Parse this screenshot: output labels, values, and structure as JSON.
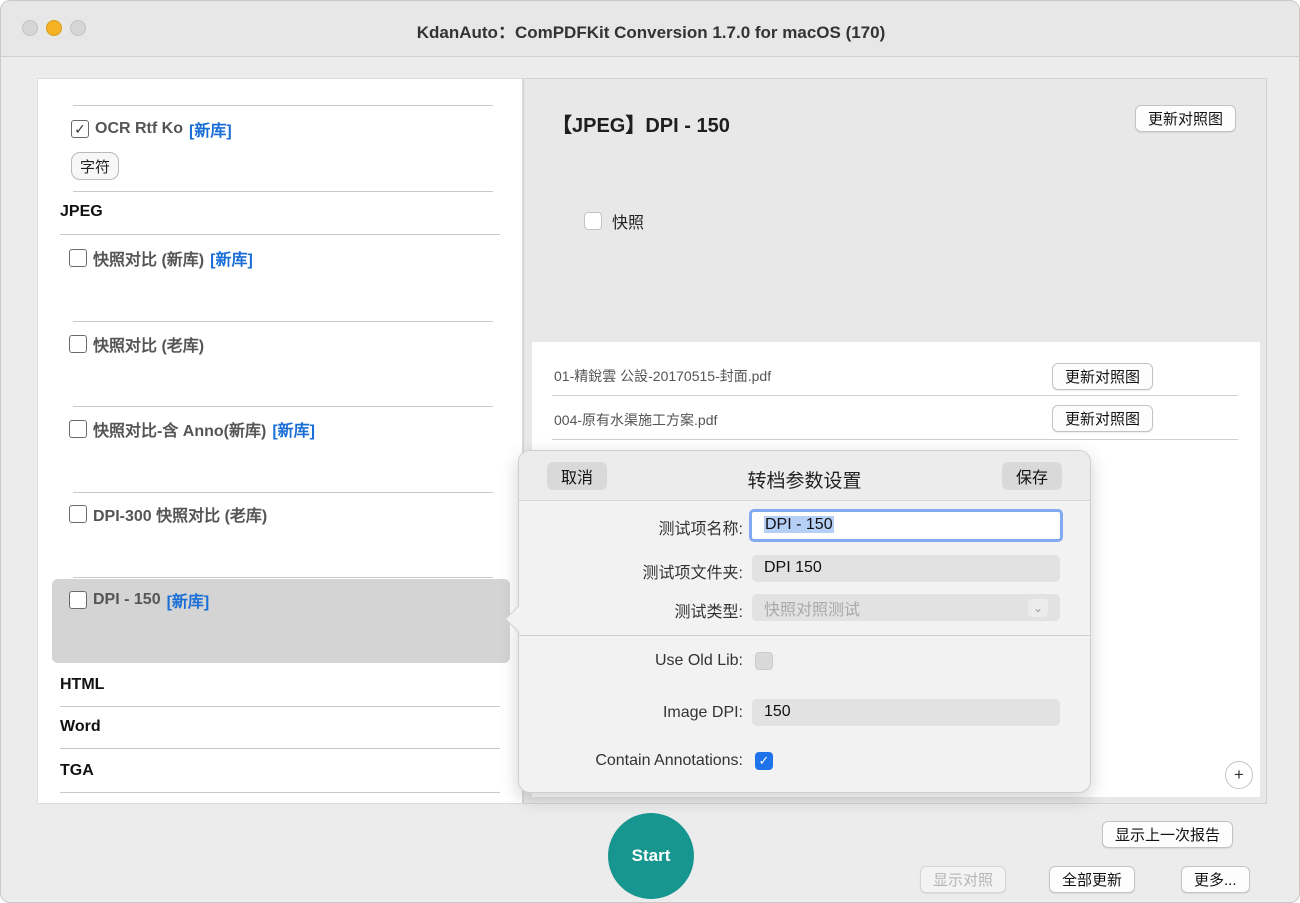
{
  "window": {
    "title": "KdanAuto：ComPDFKit Conversion 1.7.0 for macOS (170)"
  },
  "left_list": {
    "ocr_item": {
      "label": "OCR Rtf Ko",
      "tag": "[新库]",
      "checked": "✓"
    },
    "char_button": "字符",
    "sections": {
      "jpeg": "JPEG",
      "html": "HTML",
      "word": "Word",
      "tga": "TGA"
    },
    "jpeg_items": [
      {
        "label": "快照对比 (新库)",
        "tag": "[新库]"
      },
      {
        "label": "快照对比 (老库)",
        "tag": ""
      },
      {
        "label": "快照对比-含 Anno(新库)",
        "tag": "[新库]"
      },
      {
        "label": "DPI-300 快照对比 (老库)",
        "tag": ""
      },
      {
        "label": "DPI - 150",
        "tag": "[新库]"
      }
    ]
  },
  "detail": {
    "title": "【JPEG】DPI - 150",
    "update_button": "更新对照图",
    "snapshot_label": "快照",
    "files": [
      {
        "name": "01-精銳雲 公設-20170515-封面.pdf",
        "button": "更新对照图"
      },
      {
        "name": "004-原有水渠施工方案.pdf",
        "button": "更新对照图"
      }
    ],
    "add_button": "+"
  },
  "popover": {
    "title": "转档参数设置",
    "cancel": "取消",
    "save": "保存",
    "fields": {
      "name_label": "测试项名称:",
      "name_value": "DPI - 150",
      "folder_label": "测试项文件夹:",
      "folder_value": "DPI 150",
      "type_label": "测试类型:",
      "type_value": "快照对照测试",
      "old_lib_label": "Use Old Lib:",
      "dpi_label": "Image DPI:",
      "dpi_value": "150",
      "annotations_label": "Contain Annotations:",
      "annotations_check": "✓"
    }
  },
  "bottom": {
    "start": "Start",
    "show_last_report": "显示上一次报告",
    "show_compare": "显示对照",
    "update_all": "全部更新",
    "more": "更多..."
  }
}
